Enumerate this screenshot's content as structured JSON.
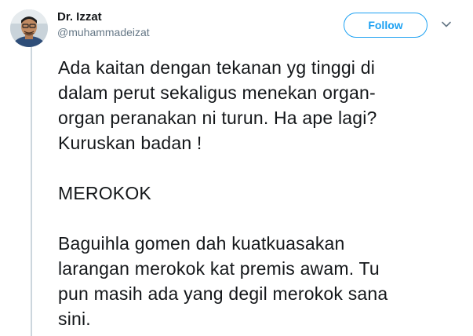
{
  "author": {
    "display_name": "Dr. Izzat",
    "handle": "@muhammadeizat"
  },
  "actions": {
    "follow_label": "Follow",
    "menu_icon": "chevron-down-icon"
  },
  "tweet": {
    "paragraphs": [
      {
        "lines": [
          "Ada kaitan dengan tekanan yg tinggi di",
          "dalam perut sekaligus menekan organ-",
          "organ peranakan ni turun. Ha ape lagi?",
          "Kuruskan badan !"
        ]
      },
      {
        "lines": [
          "MEROKOK"
        ]
      },
      {
        "lines": [
          "Baguihla gomen dah kuatkuasakan",
          "larangan merokok kat premis awam. Tu",
          "pun masih ada yang degil merokok sana",
          "sini."
        ]
      }
    ]
  },
  "colors": {
    "accent": "#1da1f2",
    "text": "#14171a",
    "muted": "#657786",
    "thread_line": "#ccd6dd"
  }
}
